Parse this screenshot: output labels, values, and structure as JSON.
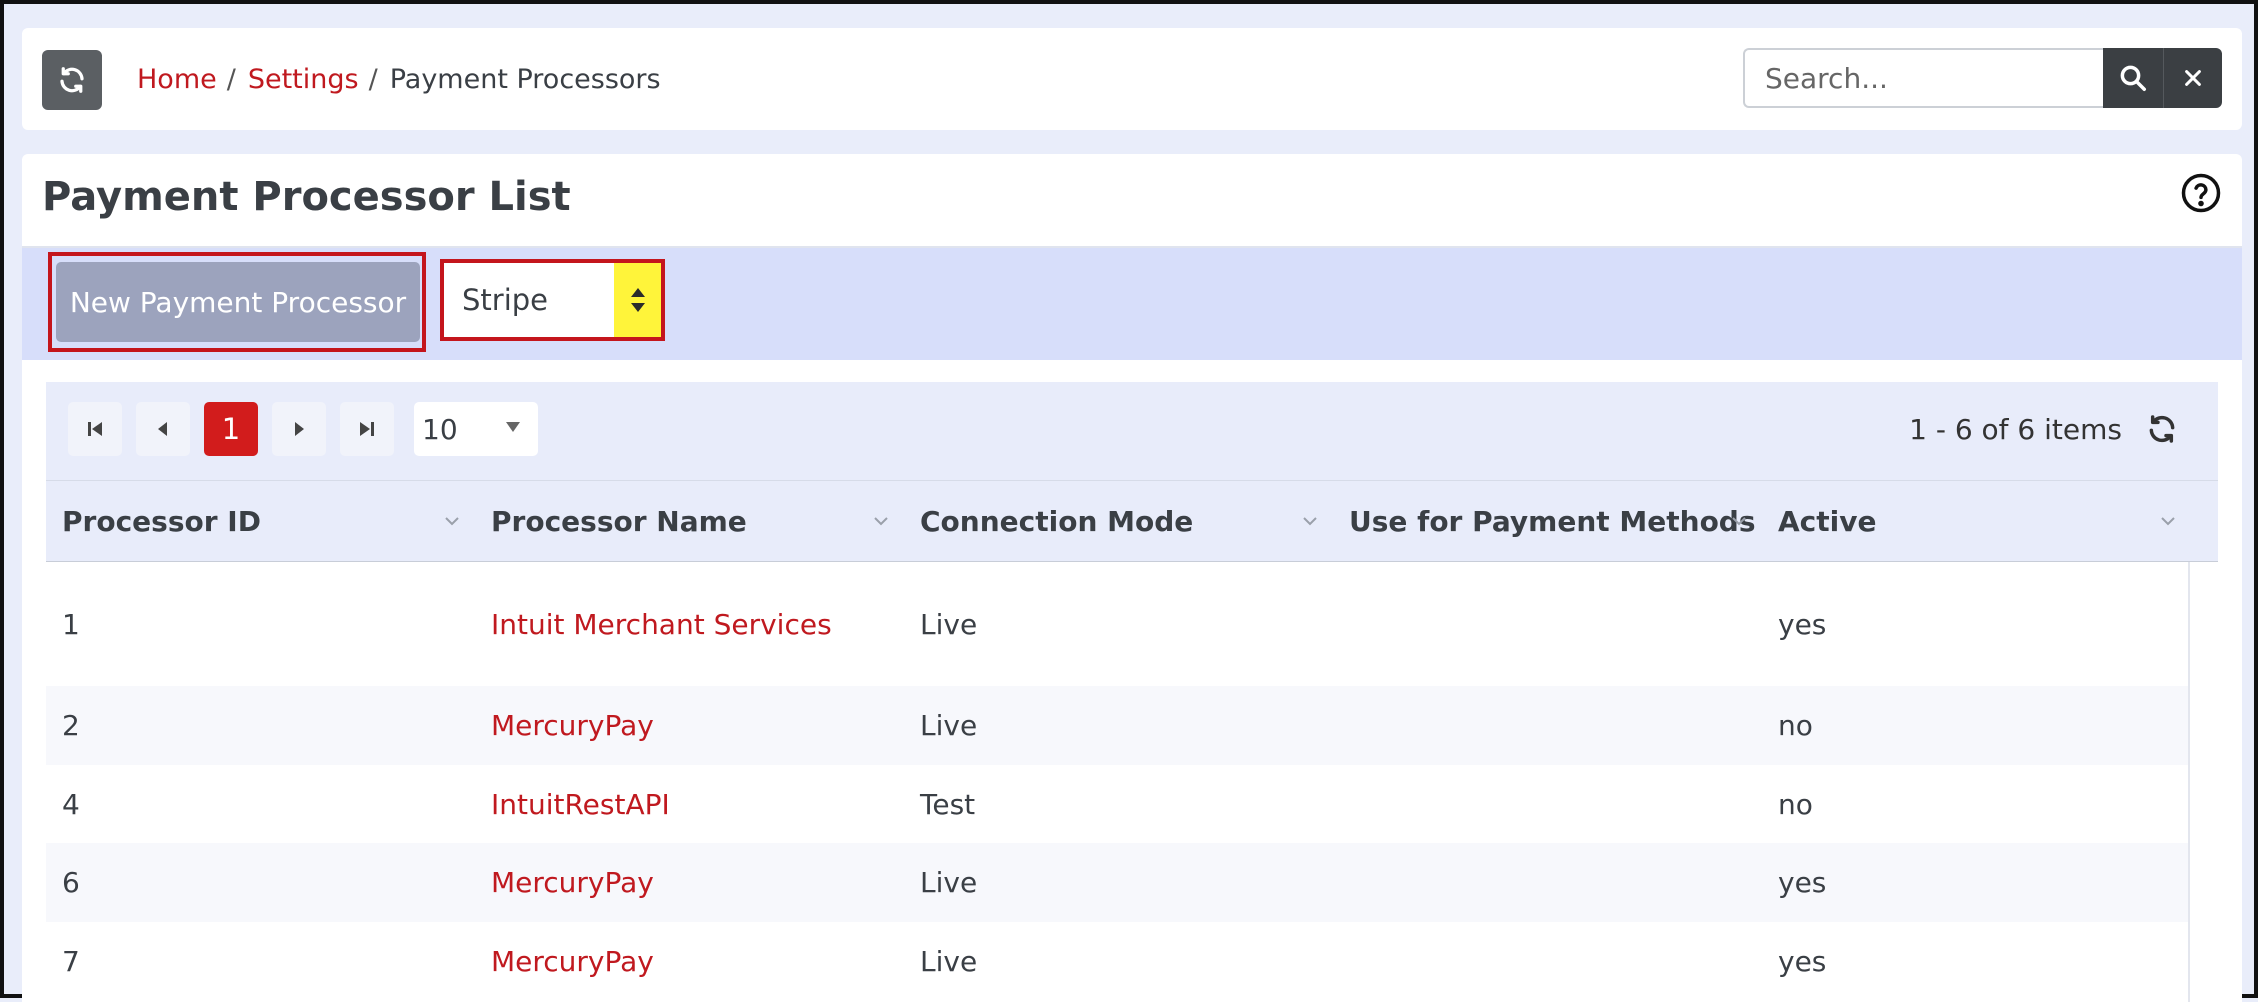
{
  "breadcrumb": {
    "home": "Home",
    "settings": "Settings",
    "separator": "/",
    "current": "Payment Processors"
  },
  "search": {
    "placeholder": "Search..."
  },
  "page": {
    "title": "Payment Processor List"
  },
  "toolbar": {
    "new_button": "New Payment Processor",
    "processor_select_value": "Stripe"
  },
  "pager": {
    "current_page": "1",
    "page_size": "10",
    "items_info": "1 - 6 of 6 items"
  },
  "table": {
    "columns": [
      "Processor ID",
      "Processor Name",
      "Connection Mode",
      "Use for Payment Methods",
      "Active"
    ],
    "rows": [
      {
        "id": "1",
        "name": "Intuit Merchant Services",
        "mode": "Live",
        "use_for": "",
        "active": "yes"
      },
      {
        "id": "2",
        "name": "MercuryPay",
        "mode": "Live",
        "use_for": "",
        "active": "no"
      },
      {
        "id": "4",
        "name": "IntuitRestAPI",
        "mode": "Test",
        "use_for": "",
        "active": "no"
      },
      {
        "id": "6",
        "name": "MercuryPay",
        "mode": "Live",
        "use_for": "",
        "active": "yes"
      },
      {
        "id": "7",
        "name": "MercuryPay",
        "mode": "Live",
        "use_for": "",
        "active": "yes"
      }
    ]
  },
  "colors": {
    "link": "#c0191f",
    "highlight_outline": "#c4151c",
    "toolbar_bg": "#d7defa",
    "select_arrow_bg": "#fff43a",
    "current_page_bg": "#d21c1c"
  },
  "icons": {
    "refresh": "refresh-icon",
    "search": "search-icon",
    "clear": "close-icon",
    "help": "help-circle-icon",
    "first": "first-page-icon",
    "prev": "prev-page-icon",
    "next": "next-page-icon",
    "last": "last-page-icon",
    "sort": "chevron-down-icon"
  }
}
